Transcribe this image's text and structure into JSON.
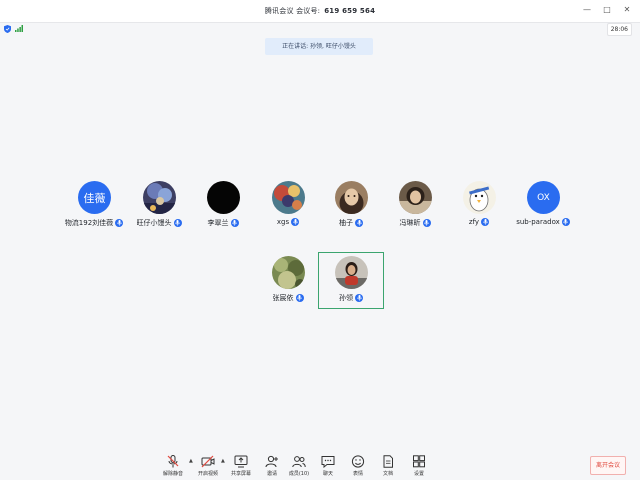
{
  "window": {
    "title": "腾讯会议 会议号:",
    "meeting_id": "619 659 564",
    "minimize": "—",
    "maximize": "□",
    "close": "✕"
  },
  "status": {
    "timer": "28:06"
  },
  "banner": {
    "text": "正在讲话: 孙领, 旺仔小馒头"
  },
  "participants": [
    {
      "name": "物流192刘佳薇",
      "avatar_text": "佳薇",
      "avatar_color": "#2a6cf0"
    },
    {
      "name": "旺仔小馒头"
    },
    {
      "name": "李翠兰"
    },
    {
      "name": "xgs"
    },
    {
      "name": "柚子"
    },
    {
      "name": "冯琳昕"
    },
    {
      "name": "zfy"
    },
    {
      "name": "sub-paradox",
      "avatar_text": "OX",
      "avatar_color": "#2a6cf0"
    },
    {
      "name": "张宸依"
    },
    {
      "name": "孙领"
    }
  ],
  "toolbar": {
    "mute": "解除静音",
    "video": "开启视频",
    "share": "共享屏幕",
    "invite": "邀请",
    "members": "成员(10)",
    "chat": "聊天",
    "emoji": "表情",
    "docs": "文档",
    "settings": "设置"
  },
  "leave_label": "离开会议",
  "colors": {
    "accent": "#2a6cf0",
    "active_border": "#3ba56f",
    "leave_red": "#e04a3f"
  }
}
